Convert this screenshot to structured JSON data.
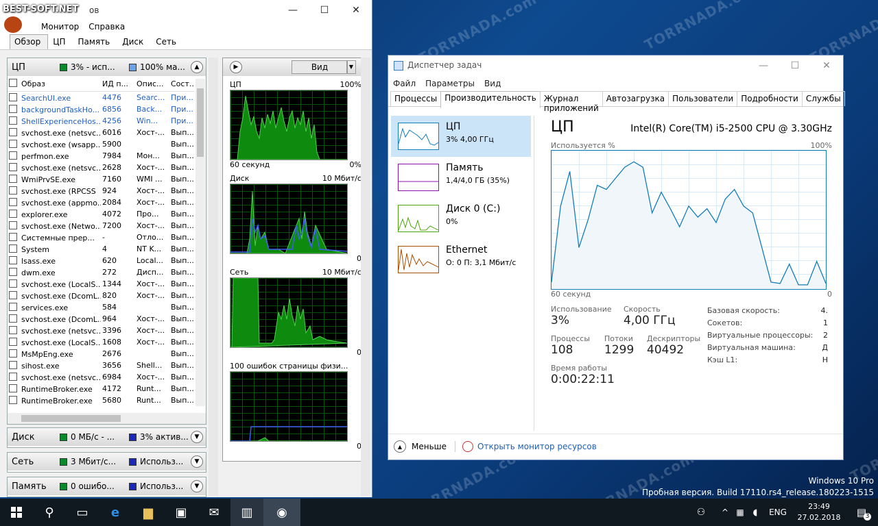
{
  "watermark": {
    "text": "TORRNADA.com",
    "logo": "BEST-SOFT.NET"
  },
  "resmon": {
    "title_fragment": "ов",
    "menu": [
      "Монитор",
      "Справка"
    ],
    "tabs": [
      "Обзор",
      "ЦП",
      "Память",
      "Диск",
      "Сеть"
    ],
    "cpu_panel": {
      "title": "ЦП",
      "stat1": "3% - исп...",
      "stat2": "100% ма..."
    },
    "columns": [
      "Образ",
      "ИД п...",
      "Опис...",
      "Сост..."
    ],
    "rows": [
      [
        "SearchUI.exe",
        "4476",
        "Searc...",
        "При..."
      ],
      [
        "backgroundTaskHo...",
        "6856",
        "Back...",
        "При..."
      ],
      [
        "ShellExperienceHos...",
        "4256",
        "Win...",
        "При..."
      ],
      [
        "svchost.exe (netsvc...",
        "6016",
        "Хост-...",
        "Вып..."
      ],
      [
        "svchost.exe (wsapp...",
        "5900",
        "",
        "Вып..."
      ],
      [
        "perfmon.exe",
        "7984",
        "Мон...",
        "Вып..."
      ],
      [
        "svchost.exe (netsvc...",
        "2628",
        "Хост-...",
        "Вып..."
      ],
      [
        "WmiPrvSE.exe",
        "7160",
        "WMI ...",
        "Вып..."
      ],
      [
        "svchost.exe (RPCSS",
        "924",
        "Хост-...",
        "Вып..."
      ],
      [
        "svchost.exe (appmo...",
        "2084",
        "Хост-...",
        "Вып..."
      ],
      [
        "explorer.exe",
        "4072",
        "Про...",
        "Вып..."
      ],
      [
        "svchost.exe (Netwo...",
        "7200",
        "Хост-...",
        "Вып..."
      ],
      [
        "Системные прер...",
        "-",
        "Отло...",
        "Вып..."
      ],
      [
        "System",
        "4",
        "NT K...",
        "Вып..."
      ],
      [
        "lsass.exe",
        "620",
        "Local...",
        "Вып..."
      ],
      [
        "dwm.exe",
        "272",
        "Дисп...",
        "Вып..."
      ],
      [
        "svchost.exe (LocalS...",
        "1344",
        "Хост-...",
        "Вып..."
      ],
      [
        "svchost.exe (DcomL...",
        "820",
        "Хост-...",
        "Вып..."
      ],
      [
        "services.exe",
        "584",
        "",
        "Вып..."
      ],
      [
        "svchost.exe (DcomL...",
        "964",
        "Хост-...",
        "Вып..."
      ],
      [
        "svchost.exe (netsvc...",
        "3396",
        "Хост-...",
        "Вып..."
      ],
      [
        "svchost.exe (LocalS...",
        "1608",
        "Хост-...",
        "Вып..."
      ],
      [
        "MsMpEng.exe",
        "2676",
        "",
        "Вып..."
      ],
      [
        "sihost.exe",
        "3656",
        "Shell...",
        "Вып..."
      ],
      [
        "svchost.exe (netsvc...",
        "6984",
        "Хост-...",
        "Вып..."
      ],
      [
        "RuntimeBroker.exe",
        "4172",
        "Runt...",
        "Вып..."
      ],
      [
        "RuntimeBroker.exe",
        "5680",
        "Runt...",
        "Вып..."
      ]
    ],
    "disk_panel": {
      "title": "Диск",
      "stat1": "0 МБ/с - ...",
      "stat2": "3% актив..."
    },
    "net_panel": {
      "title": "Сеть",
      "stat1": "3 Мбит/с...",
      "stat2": "Использ..."
    },
    "mem_panel": {
      "title": "Память",
      "stat1": "0 ошибо...",
      "stat2": "Использ..."
    },
    "view_button": "Вид",
    "graphs": [
      {
        "name": "ЦП",
        "max": "100%",
        "foot_left": "60 секунд",
        "foot_right": "0%"
      },
      {
        "name": "Диск",
        "max": "10 Мбит/с",
        "foot_left": "",
        "foot_right": "0"
      },
      {
        "name": "Сеть",
        "max": "10 Мбит/с",
        "foot_left": "",
        "foot_right": "0"
      },
      {
        "name": "100 ошибок страницы физи...",
        "max": "",
        "foot_left": "",
        "foot_right": "0"
      }
    ]
  },
  "taskmgr": {
    "title": "Диспетчер задач",
    "menu": [
      "Файл",
      "Параметры",
      "Вид"
    ],
    "tabs": [
      "Процессы",
      "Производительность",
      "Журнал приложений",
      "Автозагрузка",
      "Пользователи",
      "Подробности",
      "Службы"
    ],
    "side": [
      {
        "name": "ЦП",
        "sub": "3% 4,00 ГГц",
        "color": "#117dbb"
      },
      {
        "name": "Память",
        "sub": "1,4/4,0 ГБ (35%)",
        "color": "#8b12ae"
      },
      {
        "name": "Диск 0 (C:)",
        "sub": "0%",
        "color": "#4da60c"
      },
      {
        "name": "Ethernet",
        "sub": "О: 0 П: 3,1 Мбит/с",
        "color": "#a74f01"
      }
    ],
    "cpu": {
      "heading": "ЦП",
      "model": "Intel(R) Core(TM) i5-2500 CPU @ 3.30GHz",
      "used_label": "Используется %",
      "max_label": "100%",
      "time_label": "60 секунд",
      "zero_label": "0",
      "usage_label": "Использование",
      "usage": "3%",
      "speed_label": "Скорость",
      "speed": "4,00 ГГц",
      "procs_label": "Процессы",
      "procs": "108",
      "threads_label": "Потоки",
      "threads": "1299",
      "handles_label": "Дескрипторы",
      "handles": "40492",
      "uptime_label": "Время работы",
      "uptime": "0:00:22:11",
      "right": [
        [
          "Базовая скорость:",
          "4."
        ],
        [
          "Сокетов:",
          "1"
        ],
        [
          "Виртуальные процессоры:",
          "2"
        ],
        [
          "Виртуальная машина:",
          "Д"
        ],
        [
          "Кэш L1:",
          "Н"
        ]
      ],
      "usage_series": [
        5,
        60,
        85,
        30,
        50,
        75,
        72,
        80,
        88,
        92,
        88,
        55,
        70,
        58,
        45,
        60,
        52,
        58,
        48,
        65,
        72,
        60,
        55,
        30,
        5,
        4,
        18,
        3,
        3,
        20,
        4
      ]
    },
    "fewer": "Меньше",
    "open_resmon": "Открыть монитор ресурсов"
  },
  "desktop": {
    "os": "Windows 10 Pro",
    "build": "Пробная версия. Build 17110.rs4_release.180223-1515"
  },
  "taskbar": {
    "lang": "ENG",
    "time": "23:49",
    "date": "27.02.2018",
    "notif": "3"
  }
}
